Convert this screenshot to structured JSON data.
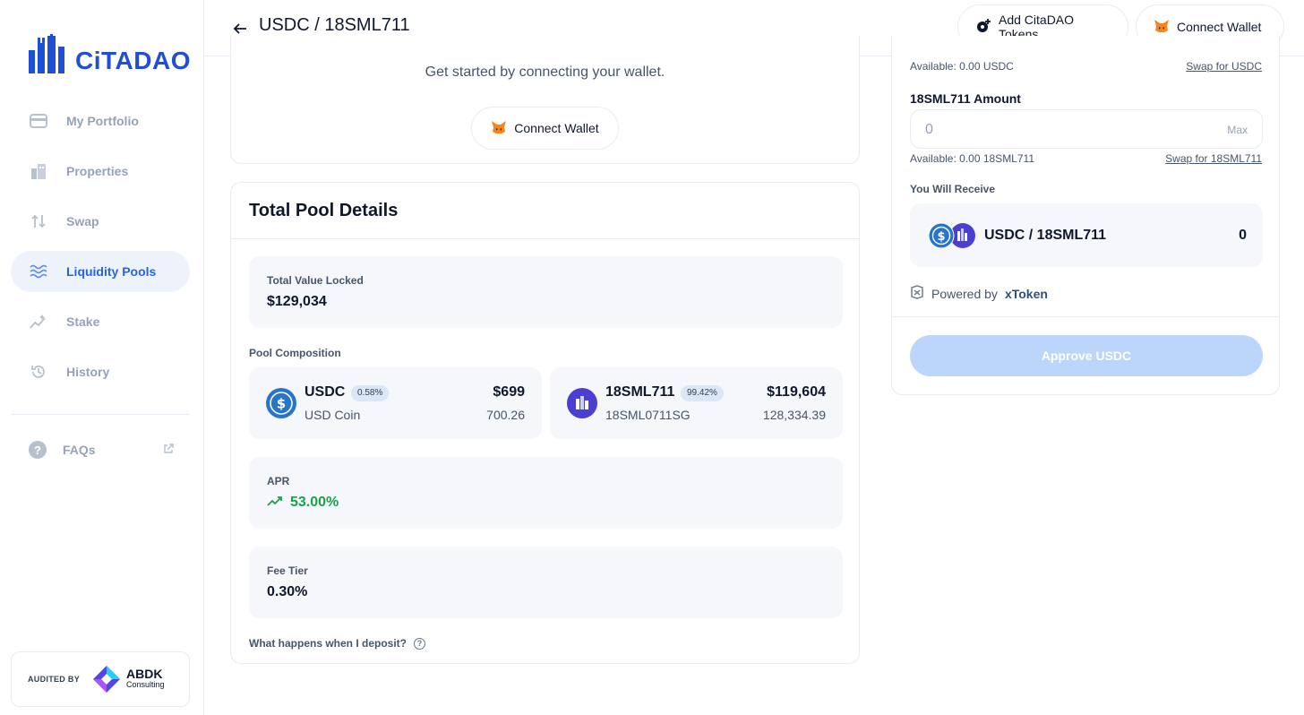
{
  "brand": {
    "name": "CiTADAO",
    "accent": "#1f4fd8"
  },
  "sidebar": {
    "items": [
      {
        "label": "My Portfolio",
        "icon": "wallet-icon",
        "active": false
      },
      {
        "label": "Properties",
        "icon": "buildings-icon",
        "active": false
      },
      {
        "label": "Swap",
        "icon": "swap-arrows-icon",
        "active": false
      },
      {
        "label": "Liquidity Pools",
        "icon": "waves-icon",
        "active": true
      },
      {
        "label": "Stake",
        "icon": "sparkle-chart-icon",
        "active": false
      },
      {
        "label": "History",
        "icon": "history-icon",
        "active": false
      }
    ],
    "faq": {
      "label": "FAQs",
      "icon": "question-icon"
    },
    "audit": {
      "label": "AUDITED BY",
      "company": "ABDK",
      "company_sub": "Consulting"
    }
  },
  "header": {
    "title": "USDC / 18SML711",
    "add_tokens_label": "Add CitaDAO Tokens",
    "connect_label": "Connect Wallet"
  },
  "connect_card": {
    "message": "Get started by connecting your wallet.",
    "button_label": "Connect Wallet"
  },
  "pool": {
    "title": "Total Pool Details",
    "tvl_label": "Total Value Locked",
    "tvl_value": "$129,034",
    "composition_label": "Pool Composition",
    "tokens": [
      {
        "symbol": "USDC",
        "share": "0.58%",
        "name": "USD Coin",
        "usd": "$699",
        "amount": "700.26"
      },
      {
        "symbol": "18SML711",
        "share": "99.42%",
        "name": "18SML0711SG",
        "usd": "$119,604",
        "amount": "128,334.39"
      }
    ],
    "apr_label": "APR",
    "apr_value": "53.00%",
    "fee_label": "Fee Tier",
    "fee_value": "0.30%",
    "deposit_question": "What happens when I deposit?"
  },
  "deposit": {
    "usdc_available": "Available: 0.00 USDC",
    "usdc_swap": "Swap for USDC",
    "token_amount_label": "18SML711 Amount",
    "token_amount_value": "0",
    "max_label": "Max",
    "token_available": "Available: 0.00 18SML711",
    "token_swap": "Swap for 18SML711",
    "receive_label": "You Will Receive",
    "receive_pair": "USDC / 18SML711",
    "receive_amount": "0",
    "powered_prefix": "Powered by",
    "powered_brand": "xToken",
    "approve_label": "Approve USDC"
  },
  "colors": {
    "usdc_blue": "#2775ca",
    "token_purple": "#4b3fd1",
    "apr_green": "#16a34a",
    "approve_disabled": "#bcd5fb"
  }
}
